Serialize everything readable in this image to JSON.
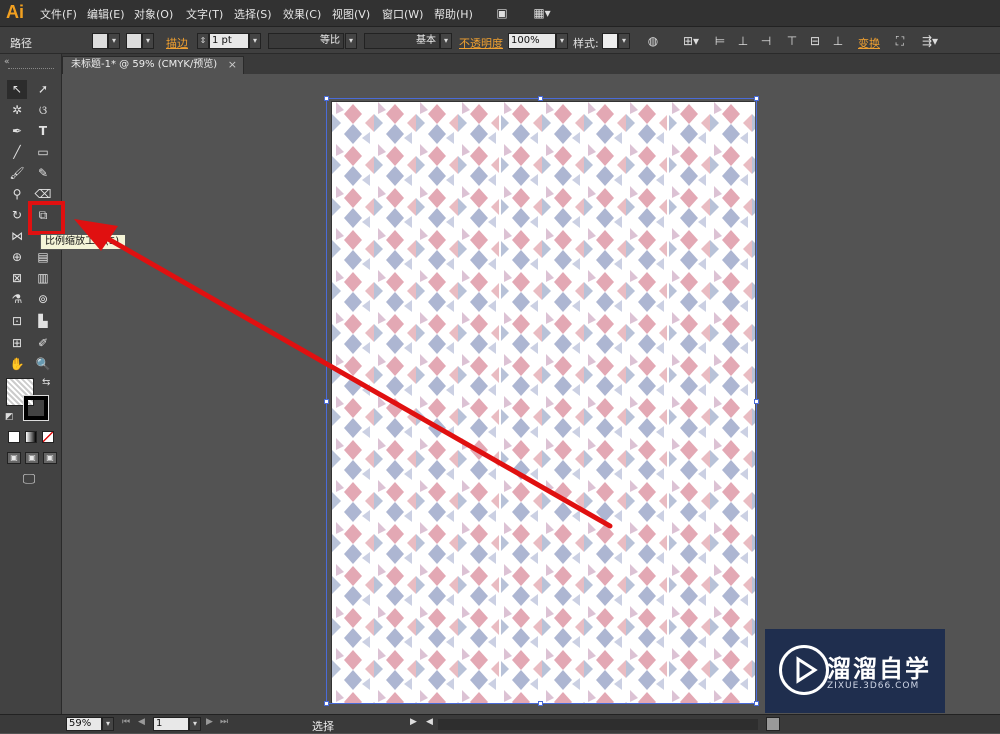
{
  "app": {
    "logo": "Ai"
  },
  "menu": [
    "文件(F)",
    "编辑(E)",
    "对象(O)",
    "文字(T)",
    "选择(S)",
    "效果(C)",
    "视图(V)",
    "窗口(W)",
    "帮助(H)"
  ],
  "control_bar": {
    "object_type": "路径",
    "stroke_label": "描边",
    "stroke_weight": "1 pt",
    "profile_label": "等比",
    "brush_label": "基本",
    "opacity_label": "不透明度",
    "opacity_value": "100%",
    "style_label": "样式:",
    "transform_label": "变换"
  },
  "document": {
    "tab_title": "未标题-1* @ 59% (CMYK/预览)",
    "close_glyph": "×"
  },
  "tooltip": "比例缩放工具(S)",
  "status_bar": {
    "zoom": "59%",
    "page": "1",
    "tool": "选择"
  },
  "watermark": {
    "title": "溜溜自学",
    "subtitle": "ZIXUE.3D66.COM"
  },
  "colors": {
    "accent_orange": "#f0a030",
    "highlight_red": "#e01010",
    "pattern_pink": "#d98a9a",
    "pattern_blue": "#8a98c0"
  }
}
